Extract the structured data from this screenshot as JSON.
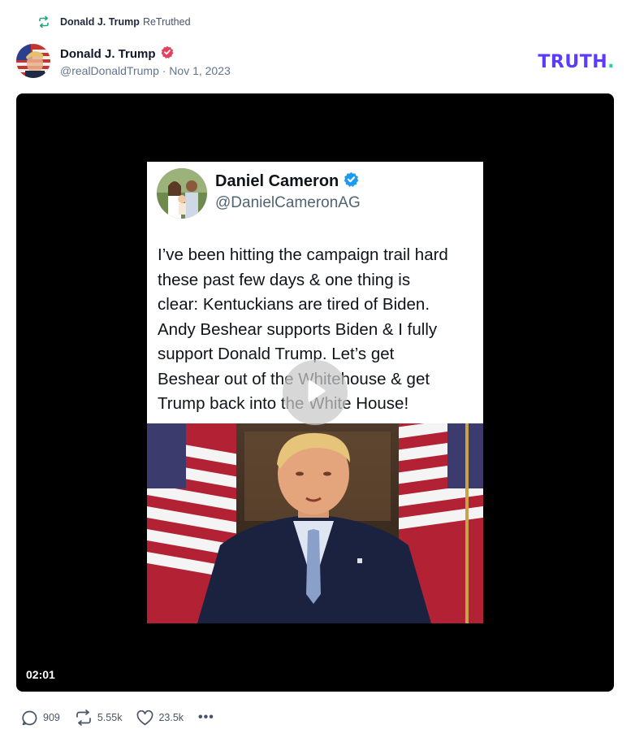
{
  "retruth": {
    "name": "Donald J. Trump",
    "suffix": "ReTruthed",
    "icon": "retruth-icon"
  },
  "post": {
    "author_name": "Donald J. Trump",
    "verified_icon": "verified-badge-icon",
    "meta": "@realDonaldTrump · Nov 1, 2023"
  },
  "brand": {
    "logo_text": "TRUTH",
    "logo_dot": ".",
    "colors": {
      "primary": "#5a3bff",
      "accent": "#12d6b0"
    }
  },
  "video": {
    "duration": "02:01",
    "play_icon": "play-icon",
    "embedded_tweet": {
      "name": "Daniel Cameron",
      "handle": "@DanielCameronAG",
      "text": "I’ve been hitting the campaign trail hard\nthese past few days & one thing is\nclear: Kentuckians are tired of Biden.\nAndy Beshear supports Biden & I fully\nsupport Donald Trump. Let’s get\nBeshear out of the Whitehouse & get\nTrump back into the White House!"
    }
  },
  "actions": {
    "replies": "909",
    "retruths": "5.55k",
    "likes": "23.5k",
    "more": "•••"
  }
}
